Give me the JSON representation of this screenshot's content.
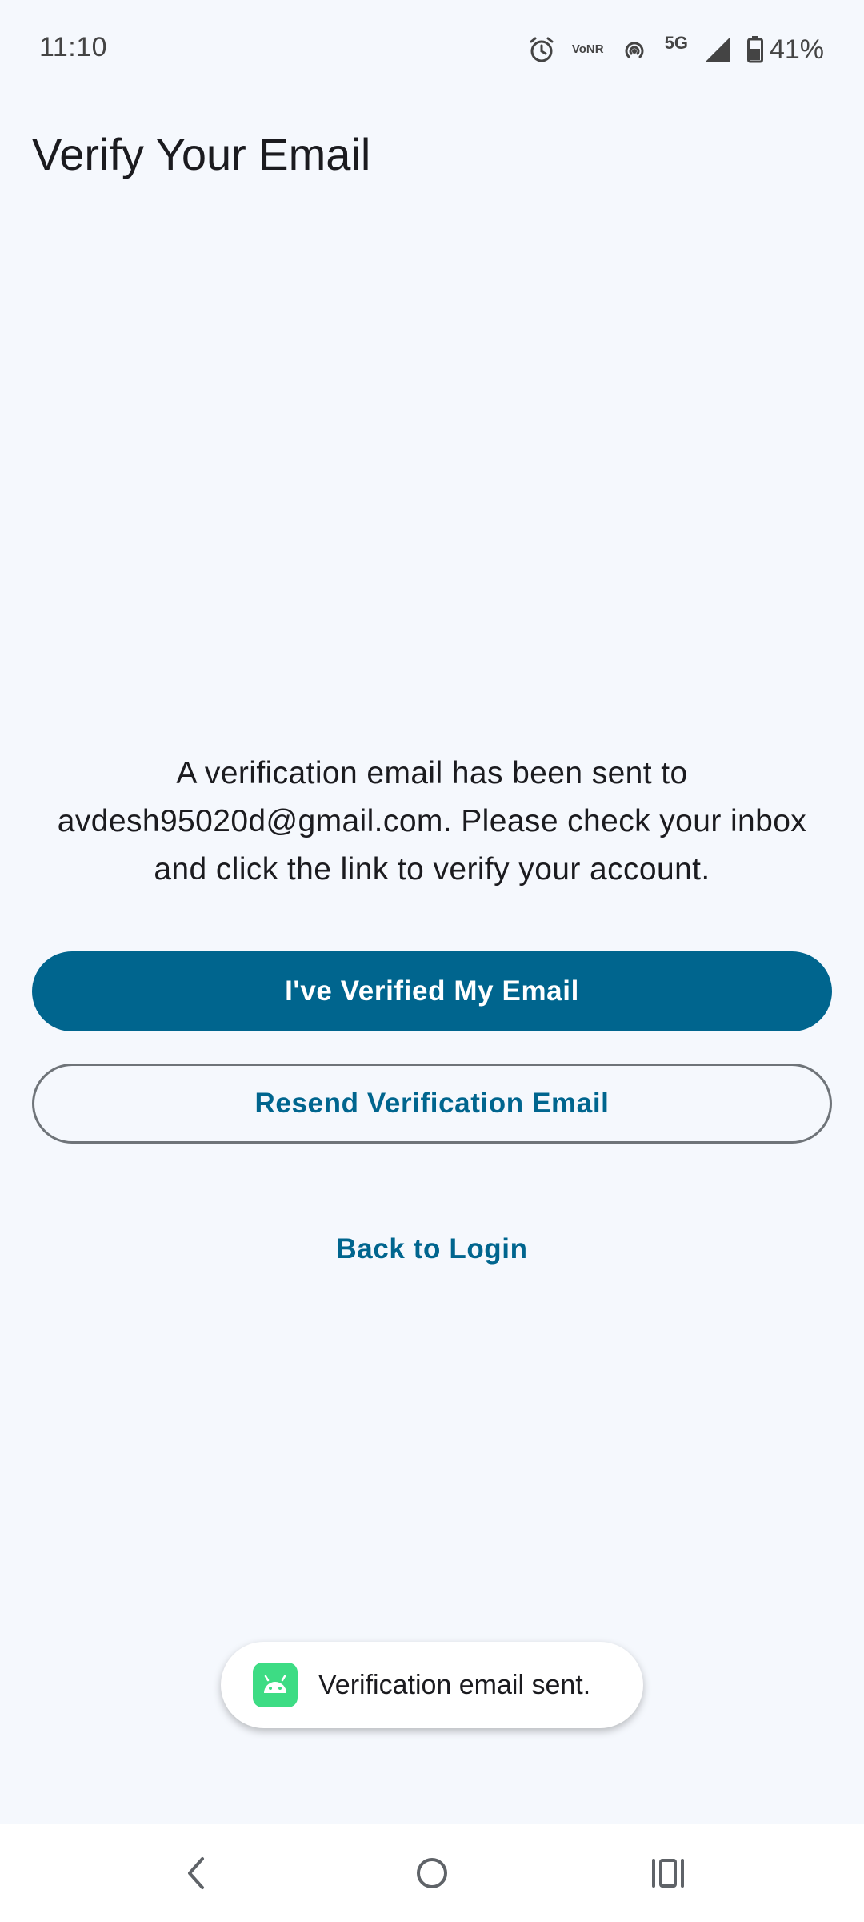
{
  "status_bar": {
    "time": "11:10",
    "vonr_line1": "Vo",
    "vonr_line2": "NR",
    "network": "5G",
    "battery": "41%",
    "icons": [
      "alarm-icon",
      "vonr-icon",
      "hotspot-icon",
      "5g-icon",
      "signal-icon",
      "battery-icon"
    ]
  },
  "page": {
    "title": "Verify Your Email",
    "message": "A verification email has been sent to avdesh95020d@gmail.com. Please check your inbox and click the link to verify your account."
  },
  "actions": {
    "verified_label": "I've Verified My Email",
    "resend_label": "Resend Verification Email",
    "back_label": "Back to Login"
  },
  "toast": {
    "text": "Verification email sent.",
    "icon": "android-app-icon"
  },
  "nav_bar": {
    "icons": [
      "back-icon",
      "home-icon",
      "recents-icon"
    ]
  },
  "colors": {
    "background": "#f5f8fd",
    "primary": "#00658e",
    "outline": "#6f7479",
    "text": "#1b1b1f",
    "toast_icon": "#3ddc84"
  }
}
